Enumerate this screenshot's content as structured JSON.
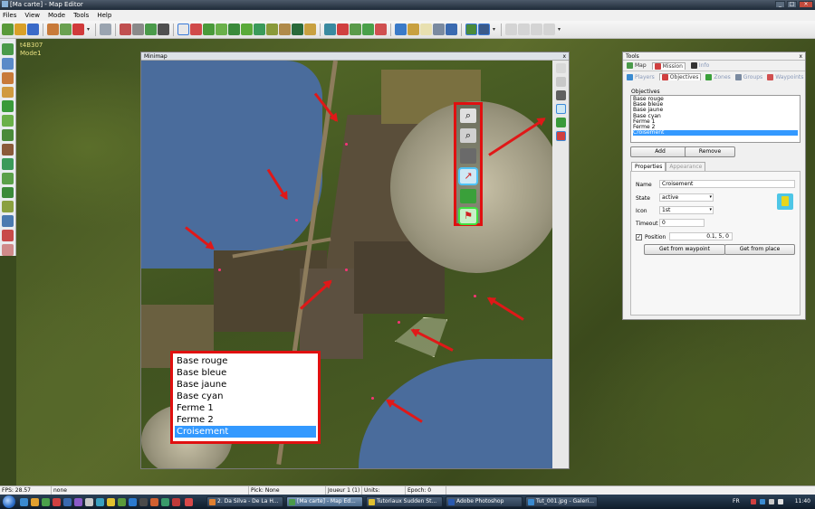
{
  "window": {
    "title": "[Ma carte] - Map Editor"
  },
  "menu": [
    "Files",
    "View",
    "Mode",
    "Tools",
    "Help"
  ],
  "world": {
    "coord_line1": "t4B307",
    "coord_line2": "Mode1"
  },
  "minimap": {
    "title": "Minimap",
    "close": "x"
  },
  "objective_overlay": {
    "items": [
      "Base rouge",
      "Base bleue",
      "Base jaune",
      "Base cyan",
      "Ferme 1",
      "Ferme 2",
      "Croisement"
    ],
    "selected_index": 6
  },
  "tools_panel": {
    "title": "Tools",
    "close": "x",
    "tabs": [
      "Map",
      "Mission",
      "Info"
    ],
    "subtabs": [
      "Players",
      "Objectives",
      "Zones",
      "Groups",
      "Waypoints"
    ],
    "objectives_label": "Objectives",
    "objectives": [
      "Base rouge",
      "Base bleue",
      "Base jaune",
      "Base cyan",
      "Ferme 1",
      "Ferme 2",
      "Croisement"
    ],
    "selected_index": 6,
    "add_label": "Add",
    "remove_label": "Remove",
    "prop_tabs": [
      "Properties",
      "Appearance"
    ],
    "name_label": "Name",
    "name_value": "Croisement",
    "state_label": "State",
    "state_value": "active",
    "icon_label": "Icon",
    "icon_value": "1st",
    "timeout_label": "Timeout",
    "timeout_value": "0",
    "position_label": "Position",
    "position_value": "0.1, 5, 0",
    "waypoint_button": "Get from waypoint",
    "place_button": "Get from place"
  },
  "status": {
    "fps": "FPS: 28.57",
    "selection": "none",
    "pick": "Pick: None",
    "player": "Joueur 1 (1)",
    "units": "Units:",
    "epoch": "Epoch: 0"
  },
  "taskbar": {
    "tasks": [
      "2. Da Silva - De La H...",
      "[Ma carte] - Map Ed...",
      "Tutoriaux Sudden St...",
      "Adobe Photoshop",
      "Tut_001.jpg - Galeri..."
    ],
    "active_index": 1,
    "lang": "FR",
    "clock": "11:40"
  },
  "colors": {
    "highlight_red": "#e01010",
    "selection_blue": "#3399ff",
    "waypoint_pink": "#ff3377"
  }
}
